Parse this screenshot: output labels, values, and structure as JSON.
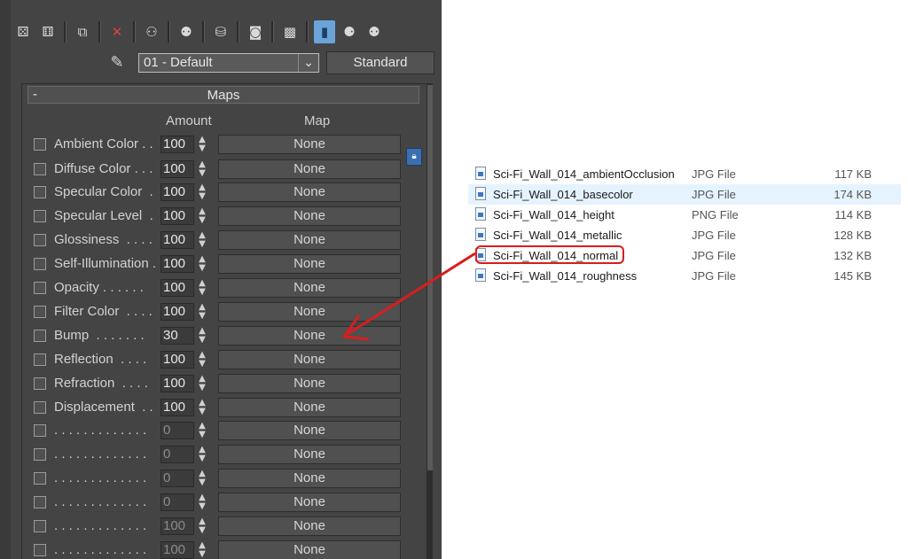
{
  "toolbar": {
    "icons": [
      "get-material-icon",
      "put-to-scene-icon",
      "assign-to-selection-icon",
      "delete-icon",
      "copy-material-icon",
      "make-unique-icon",
      "put-to-library-icon",
      "material-id-icon",
      "show-in-viewport-icon",
      "show-end-result-icon",
      "go-to-parent-icon",
      "go-forward-sibling-icon"
    ]
  },
  "material": {
    "name": "01 - Default",
    "type": "Standard"
  },
  "maps": {
    "section_toggle": "-",
    "title": "Maps",
    "col_amount": "Amount",
    "col_map": "Map",
    "rows": [
      {
        "label": "Ambient Color . .",
        "amount": "100",
        "map": "None"
      },
      {
        "label": "Diffuse Color . . .",
        "amount": "100",
        "map": "None"
      },
      {
        "label": "Specular Color  .",
        "amount": "100",
        "map": "None"
      },
      {
        "label": "Specular Level  .",
        "amount": "100",
        "map": "None"
      },
      {
        "label": "Glossiness  . . . .",
        "amount": "100",
        "map": "None"
      },
      {
        "label": "Self-Illumination .",
        "amount": "100",
        "map": "None"
      },
      {
        "label": "Opacity . . . . . .",
        "amount": "100",
        "map": "None"
      },
      {
        "label": "Filter Color  . . . .",
        "amount": "100",
        "map": "None"
      },
      {
        "label": "Bump  . . . . . . .",
        "amount": "30",
        "map": "None"
      },
      {
        "label": "Reflection  . . . .",
        "amount": "100",
        "map": "None"
      },
      {
        "label": "Refraction  . . . .",
        "amount": "100",
        "map": "None"
      },
      {
        "label": "Displacement  . .",
        "amount": "100",
        "map": "None"
      },
      {
        "label": ". . . . . . . . . . . . .",
        "amount": "0",
        "map": "None"
      },
      {
        "label": ". . . . . . . . . . . . .",
        "amount": "0",
        "map": "None"
      },
      {
        "label": ". . . . . . . . . . . . .",
        "amount": "0",
        "map": "None"
      },
      {
        "label": ". . . . . . . . . . . . .",
        "amount": "0",
        "map": "None"
      },
      {
        "label": ". . . . . . . . . . . . .",
        "amount": "100",
        "map": "None"
      },
      {
        "label": ". . . . . . . . . . . . .",
        "amount": "100",
        "map": "None"
      }
    ]
  },
  "files": [
    {
      "name": "Sci-Fi_Wall_014_ambientOcclusion",
      "type": "JPG File",
      "size": "117 KB",
      "selected": false
    },
    {
      "name": "Sci-Fi_Wall_014_basecolor",
      "type": "JPG File",
      "size": "174 KB",
      "selected": true
    },
    {
      "name": "Sci-Fi_Wall_014_height",
      "type": "PNG File",
      "size": "114 KB",
      "selected": false
    },
    {
      "name": "Sci-Fi_Wall_014_metallic",
      "type": "JPG File",
      "size": "128 KB",
      "selected": false
    },
    {
      "name": "Sci-Fi_Wall_014_normal",
      "type": "JPG File",
      "size": "132 KB",
      "selected": false
    },
    {
      "name": "Sci-Fi_Wall_014_roughness",
      "type": "JPG File",
      "size": "145 KB",
      "selected": false
    }
  ],
  "annotation": {
    "highlight_color": "#d81e1e",
    "arrow_color": "#d81e1e"
  }
}
